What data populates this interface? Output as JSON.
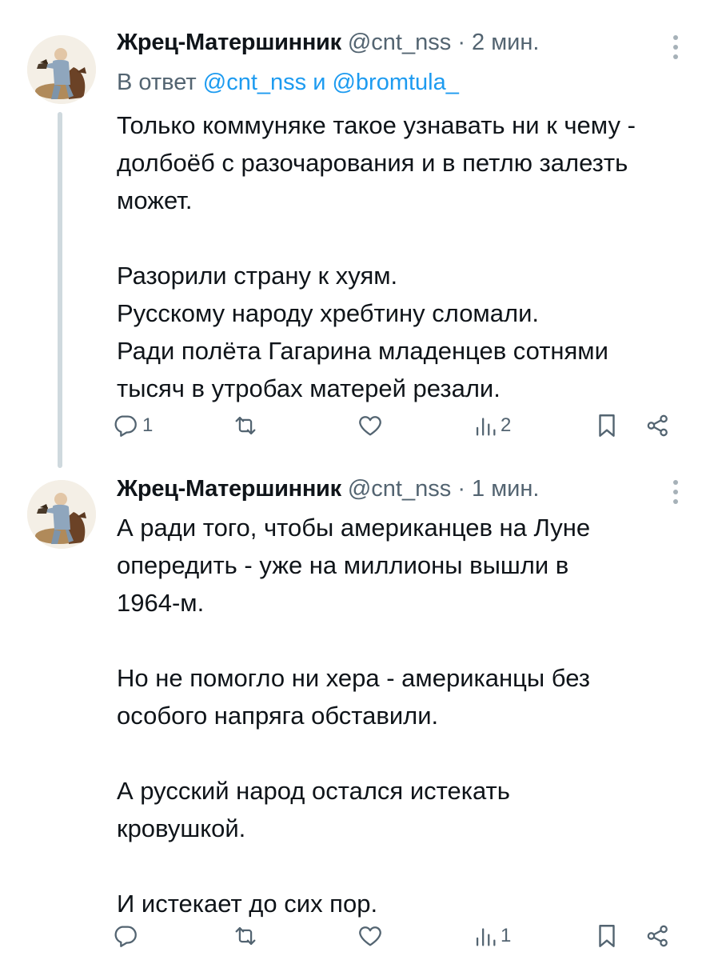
{
  "tweets": [
    {
      "author": "Жрец-Матершинник",
      "handle": "@cnt_nss",
      "separator": "·",
      "time": "2 мин.",
      "reply_prefix": "В ответ",
      "reply_mention_1": "@cnt_nss",
      "reply_conj": "и",
      "reply_mention_2": "@bromtula_",
      "lines": [
        "Только коммуняке такое узнавать ни к чему -",
        "долбоёб с разочарования и в петлю залезть",
        "может.",
        "",
        "Разорили страну к хуям.",
        "Русскому народу хребтину сломали.",
        "Ради полёта Гагарина младенцев сотнями",
        "тысяч в утробах матерей резали."
      ],
      "actions": {
        "reply_count": "1",
        "retweet_count": "",
        "like_count": "",
        "views_count": "2"
      }
    },
    {
      "author": "Жрец-Матершинник",
      "handle": "@cnt_nss",
      "separator": "·",
      "time": "1 мин.",
      "lines": [
        "А ради того, чтобы американцев на Луне",
        "опередить - уже на миллионы вышли в",
        "1964-м.",
        "",
        "Но не помогло ни хера - американцы без",
        "особого напряга обставили.",
        "",
        "А русский народ остался истекать",
        "кровушкой.",
        "",
        "И истекает до сих пор."
      ],
      "actions": {
        "reply_count": "",
        "retweet_count": "",
        "like_count": "",
        "views_count": "1"
      }
    }
  ],
  "colors": {
    "text": "#0f1419",
    "secondary": "#536471",
    "accent": "#1d9bf0",
    "thread_line": "#cfd9de"
  },
  "icons": [
    "reply-icon",
    "retweet-icon",
    "like-icon",
    "views-icon",
    "bookmark-icon",
    "share-icon",
    "more-icon"
  ]
}
